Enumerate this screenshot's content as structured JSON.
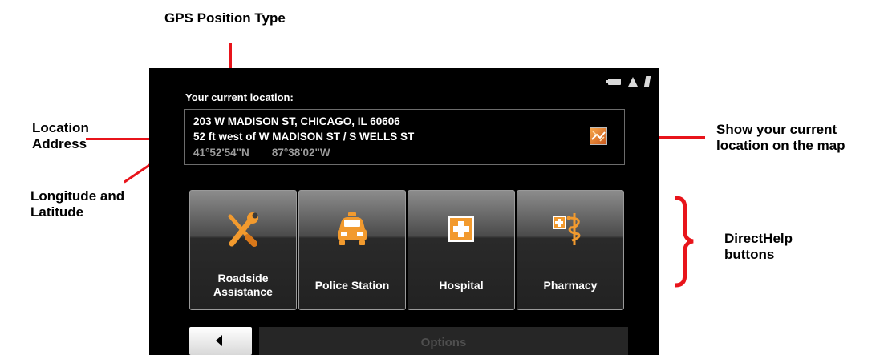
{
  "annotations": {
    "gps_position_type": "GPS Position Type",
    "location_address_1": "Location",
    "location_address_2": "Address",
    "longlat_1": "Longitude and",
    "longlat_2": "Latitude",
    "show_map_1": "Show your current",
    "show_map_2": "location on the map",
    "directhelp_1": "DirectHelp",
    "directhelp_2": "buttons"
  },
  "screen": {
    "status_icons": [
      "battery-icon",
      "warning-icon",
      "gps-signal-icon"
    ],
    "location_label": "Your current location:",
    "address_line1": "203 W MADISON ST, CHICAGO, IL 60606",
    "address_line2": "52 ft west of W MADISON ST / S WELLS ST",
    "latitude": "41°52'54\"N",
    "longitude": "87°38'02\"W",
    "map_button_icon": "map-icon",
    "help_buttons": [
      {
        "label_1": "Roadside",
        "label_2": "Assistance",
        "icon": "wrench-screwdriver-icon"
      },
      {
        "label_1": "Police Station",
        "label_2": "",
        "icon": "police-car-icon"
      },
      {
        "label_1": "Hospital",
        "label_2": "",
        "icon": "hospital-cross-icon"
      },
      {
        "label_1": "Pharmacy",
        "label_2": "",
        "icon": "pharmacy-caduceus-icon"
      }
    ],
    "back_button_icon": "back-arrow-icon",
    "options_label": "Options"
  },
  "colors": {
    "annotation_line": "#e8141b",
    "screen_bg": "#000000",
    "icon_orange": "#f29a2e"
  }
}
